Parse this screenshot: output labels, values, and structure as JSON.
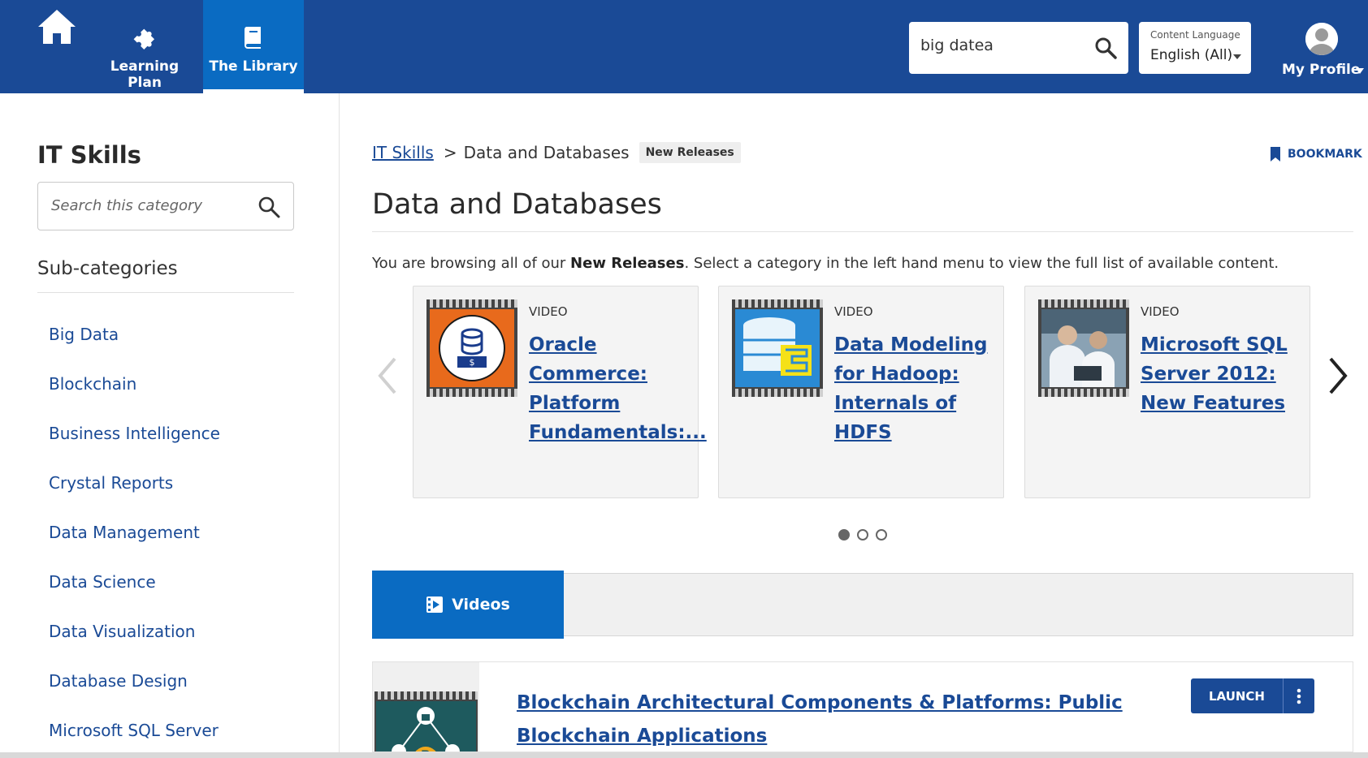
{
  "header": {
    "nav": [
      {
        "label": "Learning Plan",
        "icon": "puzzle-icon"
      },
      {
        "label": "The Library",
        "icon": "book-icon",
        "active": true
      }
    ],
    "search": {
      "value": "big datea"
    },
    "language": {
      "caption": "Content Language",
      "value": "English (All)"
    },
    "profile": {
      "label": "My Profile"
    },
    "colors": {
      "bar": "#1a4a96",
      "active_tab": "#0a6bc2"
    }
  },
  "sidebar": {
    "title": "IT Skills",
    "search_placeholder": "Search this category",
    "subcategories_title": "Sub-categories",
    "items": [
      "Big Data",
      "Blockchain",
      "Business Intelligence",
      "Crystal Reports",
      "Data Management",
      "Data Science",
      "Data Visualization",
      "Database Design",
      "Microsoft SQL Server"
    ]
  },
  "breadcrumb": {
    "root": "IT Skills",
    "separator": ">",
    "current": "Data and Databases",
    "badge": "New Releases"
  },
  "bookmark_label": "BOOKMARK",
  "page_title": "Data and Databases",
  "intro": {
    "before": "You are browsing all of our ",
    "bold": "New Releases",
    "after": ". Select a category in the left hand menu to view the full list of available content."
  },
  "carousel": {
    "cards": [
      {
        "type": "VIDEO",
        "title": "Oracle Commerce: Platform Fundamentals:..."
      },
      {
        "type": "VIDEO",
        "title": "Data Modeling for Hadoop: Internals of HDFS"
      },
      {
        "type": "VIDEO",
        "title": "Microsoft SQL Server 2012: New Features"
      }
    ],
    "page_count": 3,
    "active_page": 1
  },
  "tabs": {
    "videos_label": "Videos"
  },
  "results": [
    {
      "title": "Blockchain Architectural Components & Platforms: Public Blockchain Applications",
      "launch_label": "LAUNCH"
    }
  ]
}
